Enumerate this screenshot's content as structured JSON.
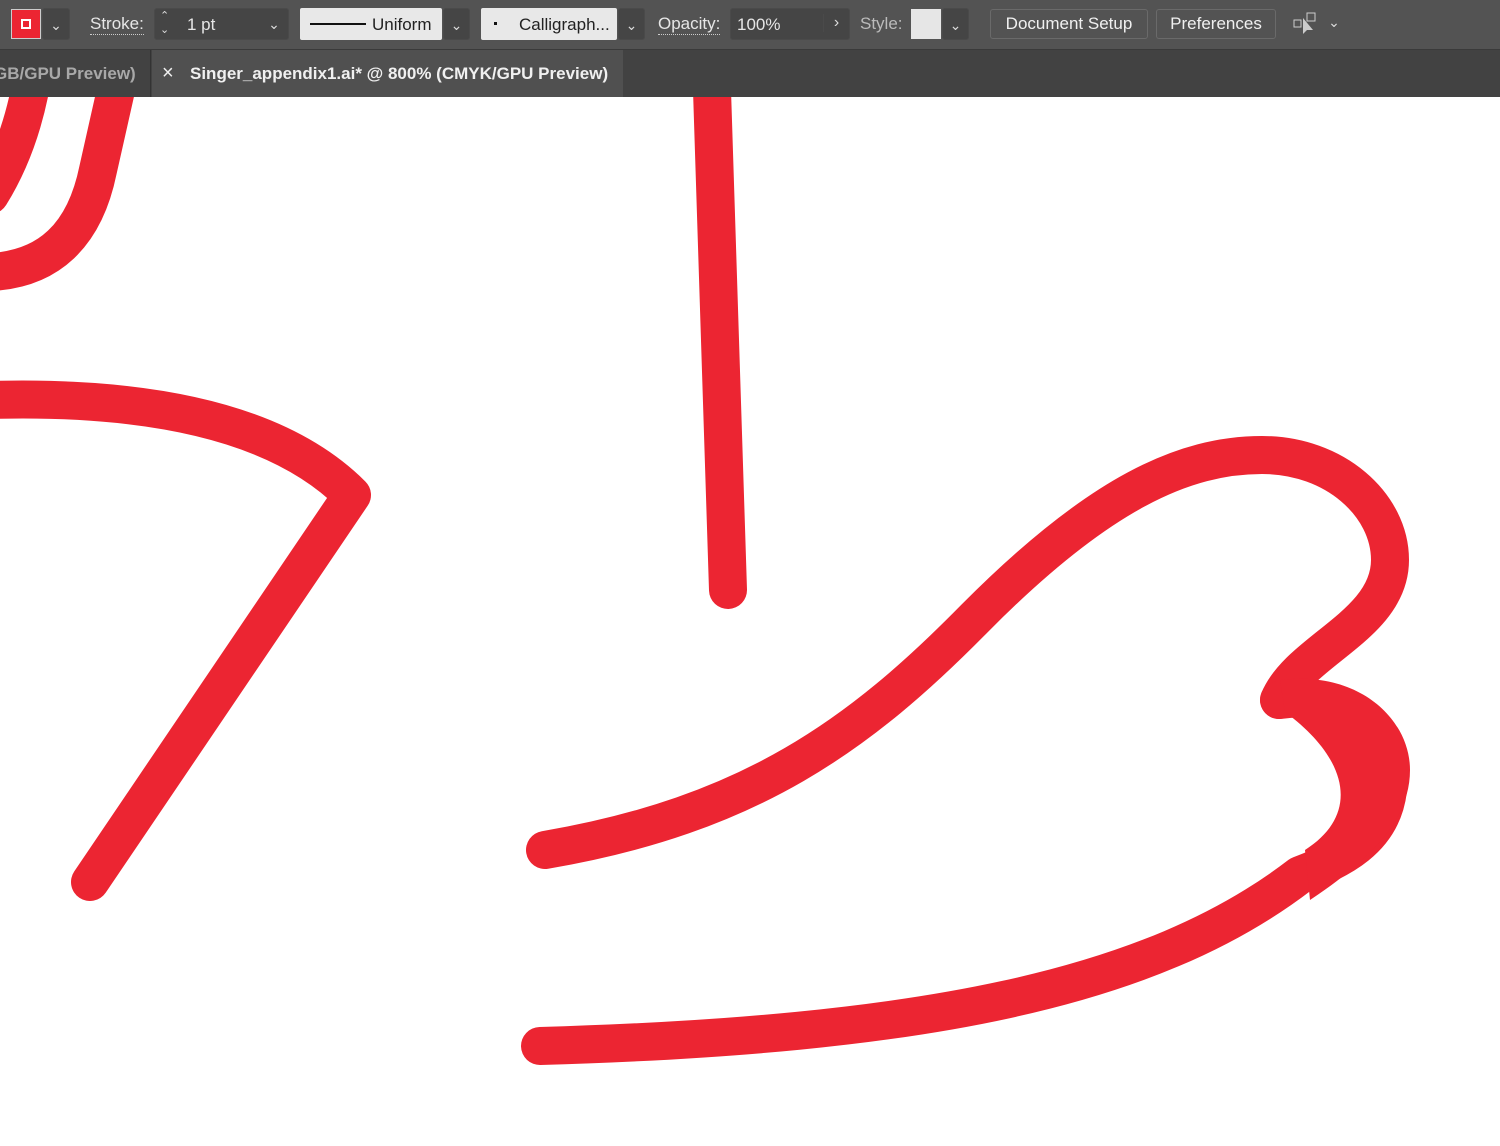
{
  "toolbar": {
    "stroke_label": "Stroke:",
    "stroke_value": "1 pt",
    "profile": "Uniform",
    "brush": "Calligraph...",
    "opacity_label": "Opacity:",
    "opacity_value": "100%",
    "style_label": "Style:",
    "document_setup": "Document Setup",
    "preferences": "Preferences"
  },
  "tabs": [
    {
      "label": "GB/GPU Preview)",
      "active": false
    },
    {
      "label": "Singer_appendix1.ai* @ 800% (CMYK/GPU Preview)",
      "active": true,
      "close": "×"
    }
  ],
  "colors": {
    "stroke": "#ec2532",
    "toolbar": "#535353",
    "tabbar": "#424242"
  }
}
